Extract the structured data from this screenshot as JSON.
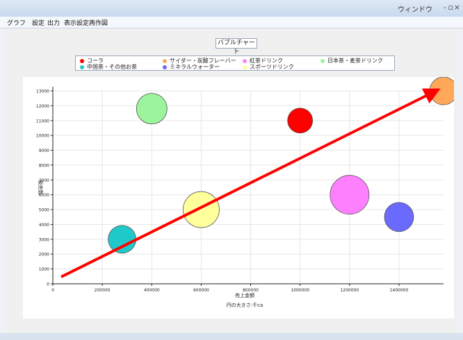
{
  "window": {
    "title": "ウィンドウ"
  },
  "menu": [
    "グラフ",
    "設定",
    "出力",
    "表示設定",
    "再作図"
  ],
  "chart_data": {
    "type": "scatter",
    "title": "バブルチャート",
    "xlabel": "売上金額",
    "ylabel": "販売数",
    "size_note": "円の大きさ:千ca",
    "xlim": [
      0,
      1580000
    ],
    "ylim": [
      0,
      13000
    ],
    "x_ticks": [
      0,
      200000,
      400000,
      600000,
      800000,
      1000000,
      1200000,
      1400000
    ],
    "y_ticks": [
      0,
      1000,
      2000,
      3000,
      4000,
      5000,
      6000,
      7000,
      8000,
      9000,
      10000,
      11000,
      12000,
      13000
    ],
    "grid": true,
    "legend_placement": "top",
    "series": [
      {
        "name": "コーラ",
        "color": "#ff0000",
        "x": 1000000,
        "y": 11000,
        "r": 18
      },
      {
        "name": "サイダー・炭酸フレーバー",
        "color": "#ffa85a",
        "x": 1580000,
        "y": 13000,
        "r": 20
      },
      {
        "name": "紅茶ドリンク",
        "color": "#ff80ff",
        "x": 1200000,
        "y": 6000,
        "r": 28
      },
      {
        "name": "日本茶・麦茶ドリンク",
        "color": "#9cf59c",
        "x": 400000,
        "y": 11800,
        "r": 22
      },
      {
        "name": "中国茶・その他お茶",
        "color": "#20c9c9",
        "x": 280000,
        "y": 3000,
        "r": 20
      },
      {
        "name": "ミネラルウォーター",
        "color": "#6a6aff",
        "x": 1400000,
        "y": 4500,
        "r": 21
      },
      {
        "name": "スポーツドリンク",
        "color": "#ffff9c",
        "x": 600000,
        "y": 5000,
        "r": 26
      }
    ]
  }
}
